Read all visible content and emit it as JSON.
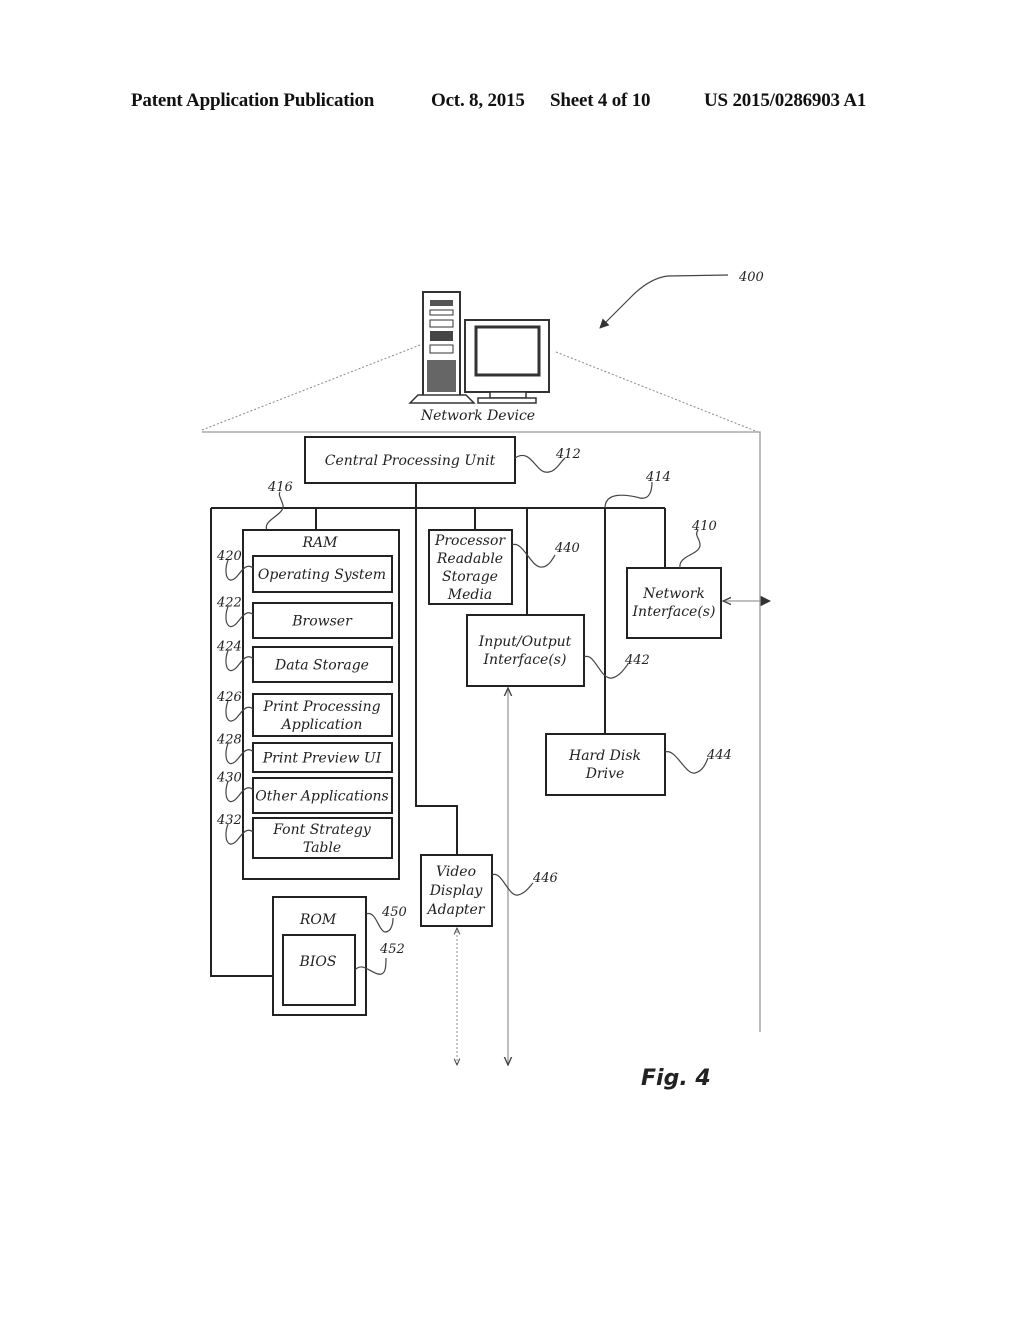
{
  "header": {
    "publication": "Patent Application Publication",
    "date": "Oct. 8, 2015",
    "sheet": "Sheet 4 of 10",
    "number": "US 2015/0286903 A1"
  },
  "figure": {
    "label": "Fig. 4",
    "ref_main": "400",
    "device_caption": "Network Device",
    "cpu": {
      "label": "Central Processing Unit",
      "ref": "412"
    },
    "bus_ref": "414",
    "memory_ref": "416",
    "ram": {
      "label": "RAM",
      "items": [
        {
          "lines": [
            "Operating System"
          ],
          "ref": "420"
        },
        {
          "lines": [
            "Browser"
          ],
          "ref": "422"
        },
        {
          "lines": [
            "Data Storage"
          ],
          "ref": "424"
        },
        {
          "lines": [
            "Print Processing",
            "Application"
          ],
          "ref": "426"
        },
        {
          "lines": [
            "Print Preview UI"
          ],
          "ref": "428"
        },
        {
          "lines": [
            "Other Applications"
          ],
          "ref": "430"
        },
        {
          "lines": [
            "Font Strategy",
            "Table"
          ],
          "ref": "432"
        }
      ]
    },
    "rom": {
      "label": "ROM",
      "ref": "450"
    },
    "bios": {
      "label": "BIOS",
      "ref": "452"
    },
    "storage_media": {
      "lines": [
        "Processor",
        "Readable",
        "Storage",
        "Media"
      ],
      "ref": "440"
    },
    "io": {
      "lines": [
        "Input/Output",
        "Interface(s)"
      ],
      "ref": "442"
    },
    "network": {
      "lines": [
        "Network",
        "Interface(s)"
      ],
      "ref": "410"
    },
    "hdd": {
      "lines": [
        "Hard Disk",
        "Drive"
      ],
      "ref": "444"
    },
    "video": {
      "lines": [
        "Video",
        "Display",
        "Adapter"
      ],
      "ref": "446"
    }
  }
}
